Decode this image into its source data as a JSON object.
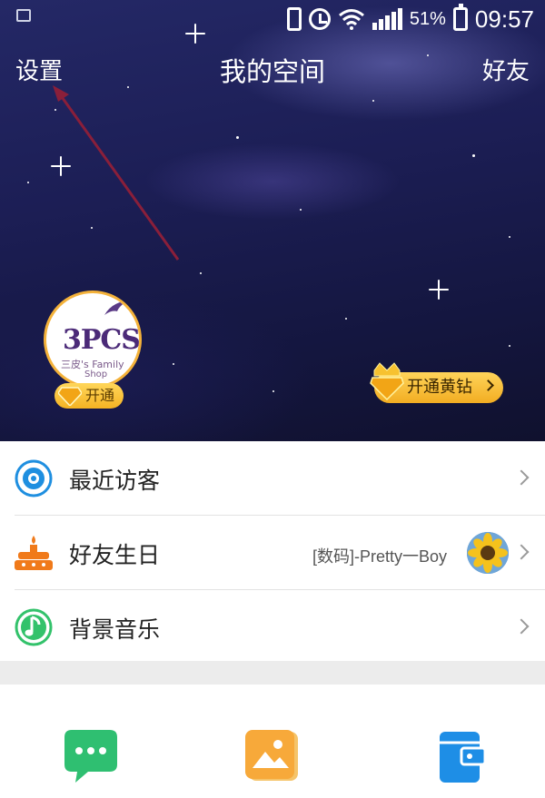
{
  "status_bar": {
    "battery_percent": "51%",
    "time": "09:57",
    "icons": [
      "device-icon",
      "vibrate-icon",
      "alarm-icon",
      "wifi-icon",
      "signal-icon",
      "battery-charging-icon"
    ]
  },
  "nav": {
    "left": "设置",
    "title": "我的空间",
    "right": "好友"
  },
  "profile": {
    "avatar_text": "3PCS",
    "avatar_sub": "三皮's Family",
    "avatar_sub2": "Shop",
    "open_badge": "开通",
    "yellow_diamond_button": "开通黄钻"
  },
  "list": {
    "items": [
      {
        "label": "最近访客",
        "icon": "eye-icon"
      },
      {
        "label": "好友生日",
        "icon": "cake-icon",
        "detail": "[数码]-Pretty一Boy"
      },
      {
        "label": "背景音乐",
        "icon": "music-note-icon"
      }
    ]
  },
  "bottom_tabs": [
    {
      "icon": "chat-bubble-icon",
      "color": "#2fbf71"
    },
    {
      "icon": "photo-icon",
      "color": "#f7a93a"
    },
    {
      "icon": "wallet-icon",
      "color": "#1e8ee6"
    }
  ],
  "colors": {
    "accent_gold": "#f5b323",
    "list_icon_blue": "#1f8fe0",
    "list_icon_orange": "#f07a1a",
    "list_icon_green": "#33c26b"
  }
}
